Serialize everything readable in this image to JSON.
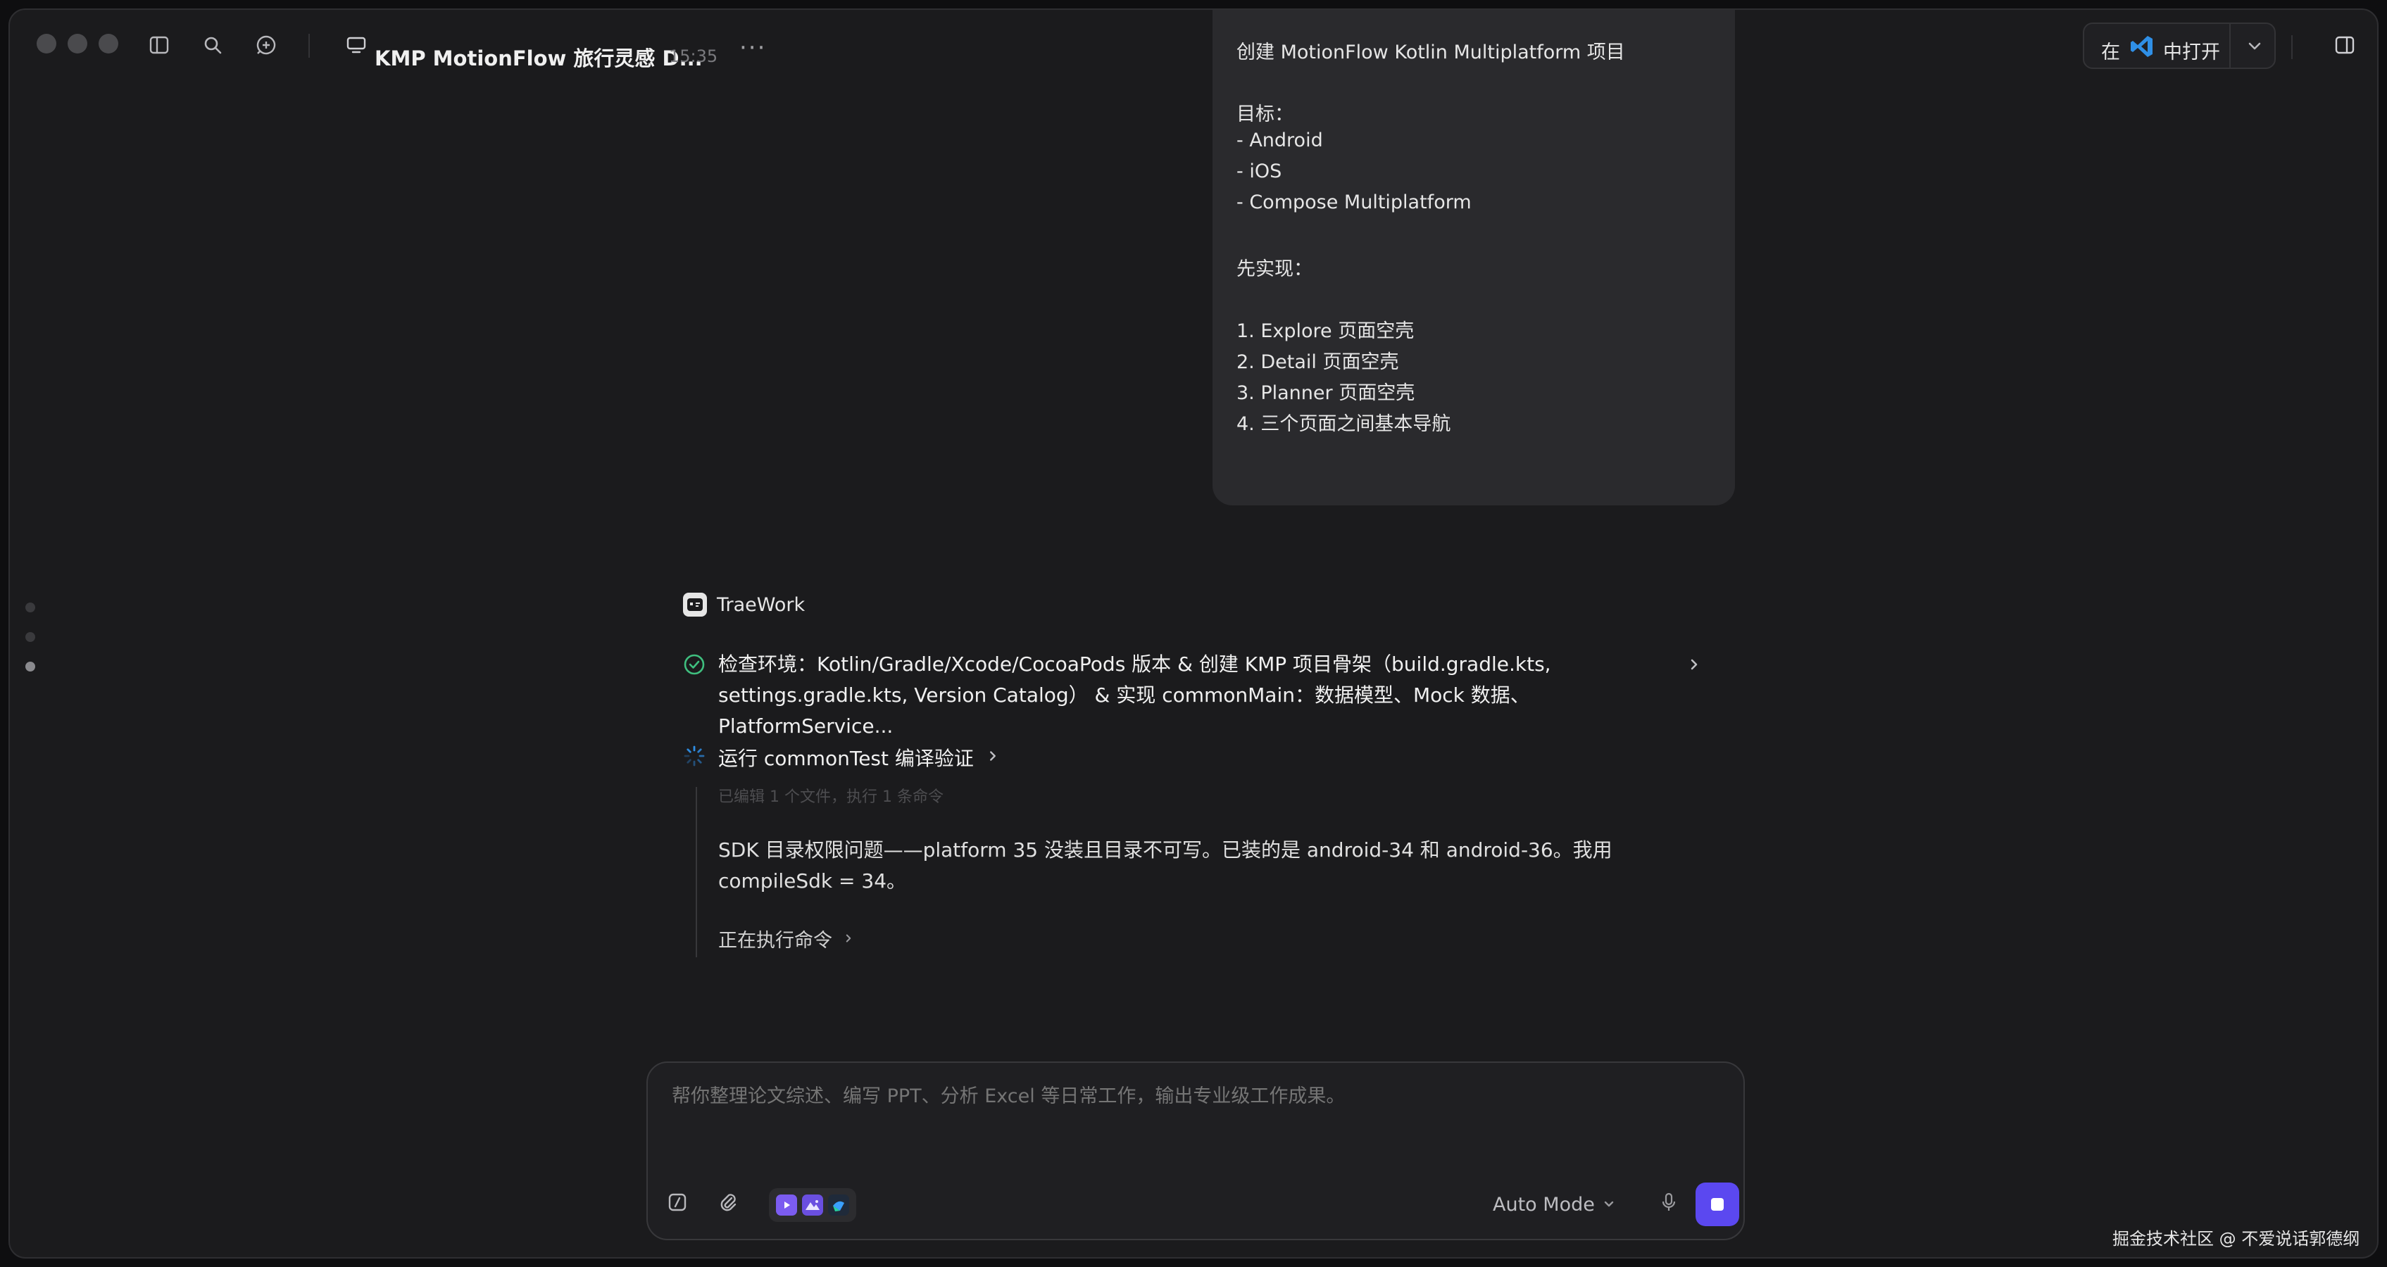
{
  "titlebar": {
    "title": "KMP MotionFlow 旅行灵感 D...",
    "time": "15:35",
    "more": "···",
    "open_in_prefix": "在",
    "open_in_label": "中打开"
  },
  "user_message": {
    "lines": [
      "创建 MotionFlow Kotlin Multiplatform 项目",
      "",
      "目标：",
      "- Android",
      "- iOS",
      "- Compose Multiplatform",
      "",
      "先实现：",
      "",
      "1. Explore 页面空壳",
      "2. Detail 页面空壳",
      "3. Planner 页面空壳",
      "4. 三个页面之间基本导航"
    ]
  },
  "assistant": {
    "name": "TraeWork",
    "step_done": "检查环境：Kotlin/Gradle/Xcode/CocoaPods 版本 & 创建 KMP 项目骨架（build.gradle.kts, settings.gradle.kts, Version Catalog） & 实现 commonMain：数据模型、Mock 数据、PlatformService...",
    "step_running": "运行 commonTest 编译验证",
    "faded_line": "已编辑 1 个文件，执行 1 条命令",
    "paragraph": "SDK 目录权限问题——platform 35 没装且目录不可写。已装的是 android-34 和 android-36。我用 compileSdk = 34。",
    "running_command": "正在执行命令"
  },
  "composer": {
    "placeholder": "帮你整理论文综述、编写 PPT、分析 Excel 等日常工作，输出专业级工作成果。",
    "mode_label": "Auto Mode"
  },
  "watermark": "掘金技术社区 @ 不爱说话郭德纲",
  "colors": {
    "accent": "#5b48f0",
    "success": "#3fbf7f",
    "vscode": "#2f8fe6"
  }
}
